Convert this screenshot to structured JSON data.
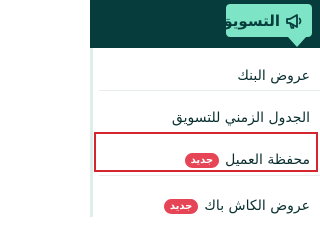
{
  "nav": {
    "label": "التسويق",
    "icon": "megaphone-icon"
  },
  "menu": {
    "items": [
      {
        "label": "عروض البنك"
      },
      {
        "label": "الجدول الزمني للتسويق"
      },
      {
        "label": "محفظة العميل",
        "badge": "جديد"
      },
      {
        "label": "عروض الكاش باك",
        "badge": "جديد"
      }
    ]
  },
  "colors": {
    "topbar": "#073c3c",
    "nav_active_bg": "#7de5c6",
    "badge_bg": "#e64556",
    "highlight_border": "#d5262f"
  }
}
